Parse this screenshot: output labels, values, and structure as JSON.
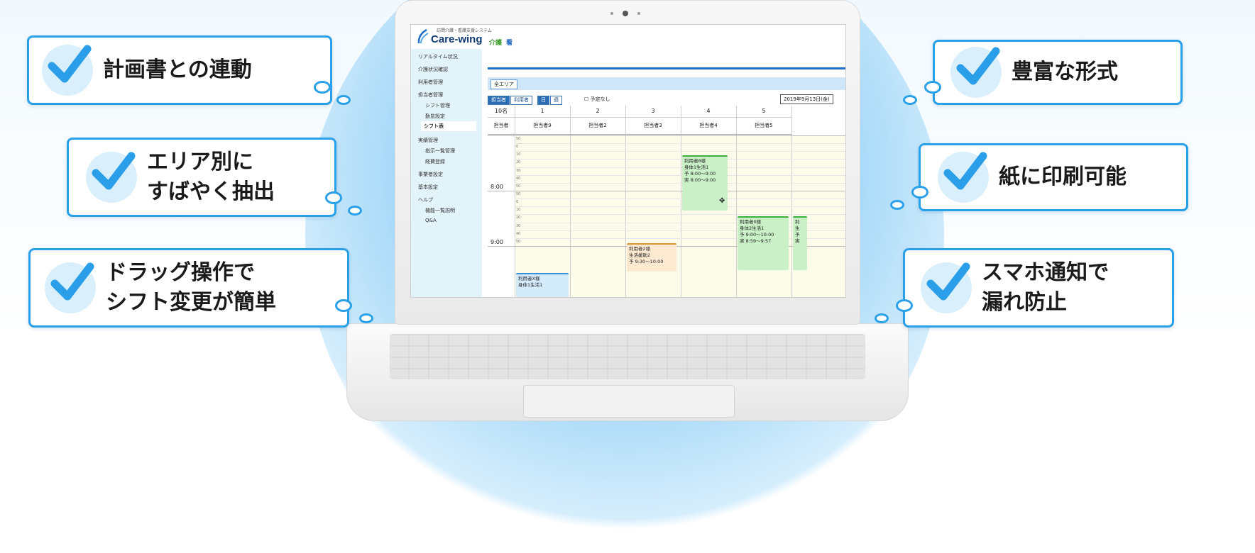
{
  "callouts_left": [
    {
      "text": "計画書との連動"
    },
    {
      "text": "エリア別に\nすばやく抽出"
    },
    {
      "text": "ドラッグ操作で\nシフト変更が簡単"
    }
  ],
  "callouts_right": [
    {
      "text": "豊富な形式"
    },
    {
      "text": "紙に印刷可能"
    },
    {
      "text": "スマホ通知で\n漏れ防止"
    }
  ],
  "colors": {
    "accent": "#2aa0e8",
    "check": "#2a9ee8",
    "brand": "#0e3b73"
  },
  "app": {
    "subtitle": "訪問介護・看護支援システム",
    "name": "Care-wing",
    "badge_care": "介護",
    "badge_nurse": "看"
  },
  "sidebar": [
    {
      "label": "リアルタイム状況"
    },
    {
      "label": "介護状況確認"
    },
    {
      "label": "利用者管理"
    },
    {
      "label": "担当者管理"
    },
    {
      "label": "シフト管理"
    },
    {
      "label": "勤怠設定"
    },
    {
      "label": "シフト表"
    },
    {
      "label": "実績管理"
    },
    {
      "label": "指示一覧管理"
    },
    {
      "label": "経費登録"
    },
    {
      "label": "事業者設定"
    },
    {
      "label": "基本設定"
    },
    {
      "label": "ヘルプ"
    },
    {
      "label": "機能一覧説明"
    },
    {
      "label": "Q&A"
    }
  ],
  "toolbar": {
    "area": "全エリア",
    "btn_staff": "担当者",
    "btn_user": "利用者",
    "btn_day": "日",
    "btn_week": "週",
    "no_schedule": "予定なし",
    "date": "2019年9月13日(金)"
  },
  "grid": {
    "count": "10名",
    "staff_label": "担当者",
    "columns": [
      {
        "num": "1",
        "name": "担当者9"
      },
      {
        "num": "2",
        "name": "担当者2"
      },
      {
        "num": "3",
        "name": "担当者3"
      },
      {
        "num": "4",
        "name": "担当者4"
      },
      {
        "num": "5",
        "name": "担当者5"
      }
    ],
    "hours": [
      "8:00",
      "9:00"
    ],
    "minutes": [
      "50",
      "0",
      "10",
      "20",
      "30",
      "40",
      "50"
    ],
    "cards": [
      {
        "title": "利用者8様",
        "l1": "身体1生活1",
        "l2": "予 8:00〜9:00",
        "l3": "実 8:00〜9:00"
      },
      {
        "title": "利用者0様",
        "l1": "身体2生活1",
        "l2": "予 9:00〜10:00",
        "l3": "実 8:59〜9:57"
      },
      {
        "title": "利用者2様",
        "l1": "生活援助2",
        "l2": "予 9:30〜10:00",
        "l3": ""
      },
      {
        "title": "利用者X様",
        "l1": "身体1生活1",
        "l2": "",
        "l3": ""
      },
      {
        "title": "利",
        "l1": "生",
        "l2": "予",
        "l3": "実"
      }
    ]
  }
}
